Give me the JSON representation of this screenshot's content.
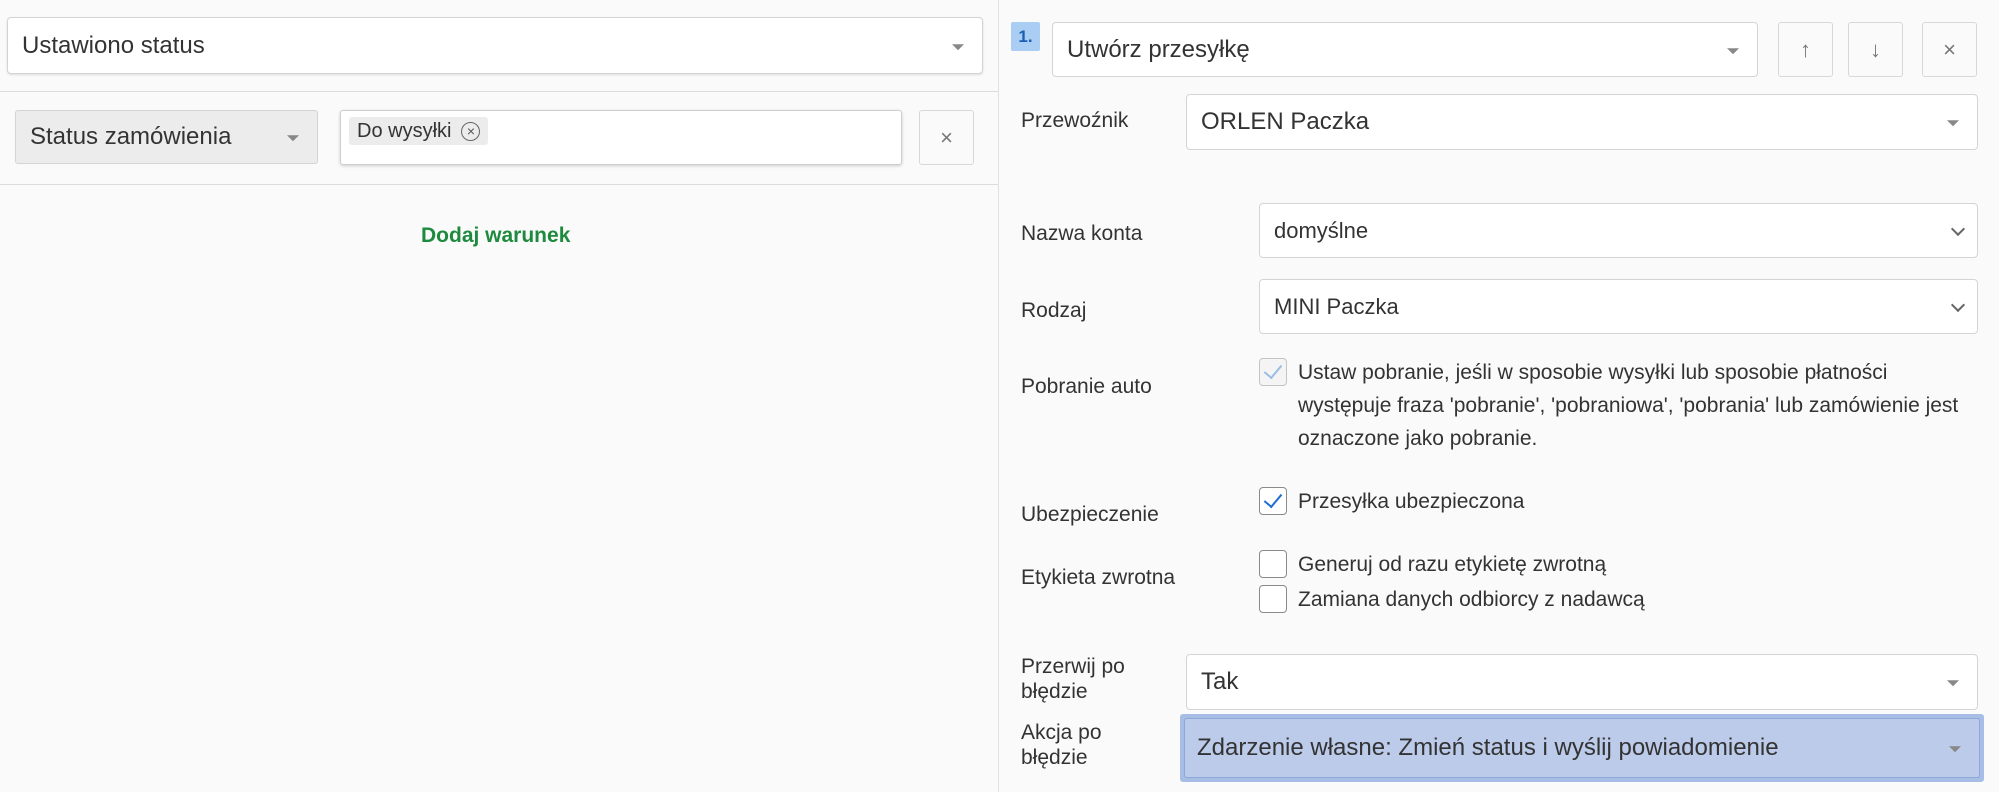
{
  "left": {
    "trigger_select": "Ustawiono status",
    "condition": {
      "field": "Status zamówienia",
      "tags": [
        "Do wysyłki"
      ],
      "remove_symbol": "×"
    },
    "add_condition": "Dodaj warunek"
  },
  "right": {
    "step_number": "1.",
    "action_select": "Utwórz przesyłkę",
    "controls": {
      "up": "↑",
      "down": "↓",
      "close": "×"
    },
    "carrier": {
      "label": "Przewoźnik",
      "value": "ORLEN Paczka"
    },
    "account": {
      "label": "Nazwa konta",
      "value": "domyślne"
    },
    "type": {
      "label": "Rodzaj",
      "value": "MINI Paczka"
    },
    "cod_auto": {
      "label": "Pobranie auto",
      "checked": true,
      "text_lines": [
        "Ustaw pobranie, jeśli w sposobie wysyłki lub sposobie płatności",
        "występuje fraza 'pobranie', 'pobraniowa', 'pobrania' lub zamówienie jest",
        "oznaczone jako pobranie."
      ]
    },
    "insurance": {
      "label": "Ubezpieczenie",
      "checkbox_text": "Przesyłka ubezpieczona",
      "checked": true
    },
    "return_label": {
      "label": "Etykieta zwrotna",
      "options": [
        {
          "text": "Generuj od razu etykietę zwrotną",
          "checked": false
        },
        {
          "text": "Zamiana danych odbiorcy z nadawcą",
          "checked": false
        }
      ]
    },
    "stop_on_error": {
      "label_lines": [
        "Przerwij po",
        "błędzie"
      ],
      "value": "Tak"
    },
    "action_on_error": {
      "label_lines": [
        "Akcja po",
        "błędzie"
      ],
      "value": "Zdarzenie własne: Zmień status i wyślij powiadomienie"
    }
  },
  "colors": {
    "accent_green": "#1e8a3e",
    "step_badge": "#a9cdf3",
    "highlight": "#bccbea",
    "check": "#1f6fd1"
  }
}
